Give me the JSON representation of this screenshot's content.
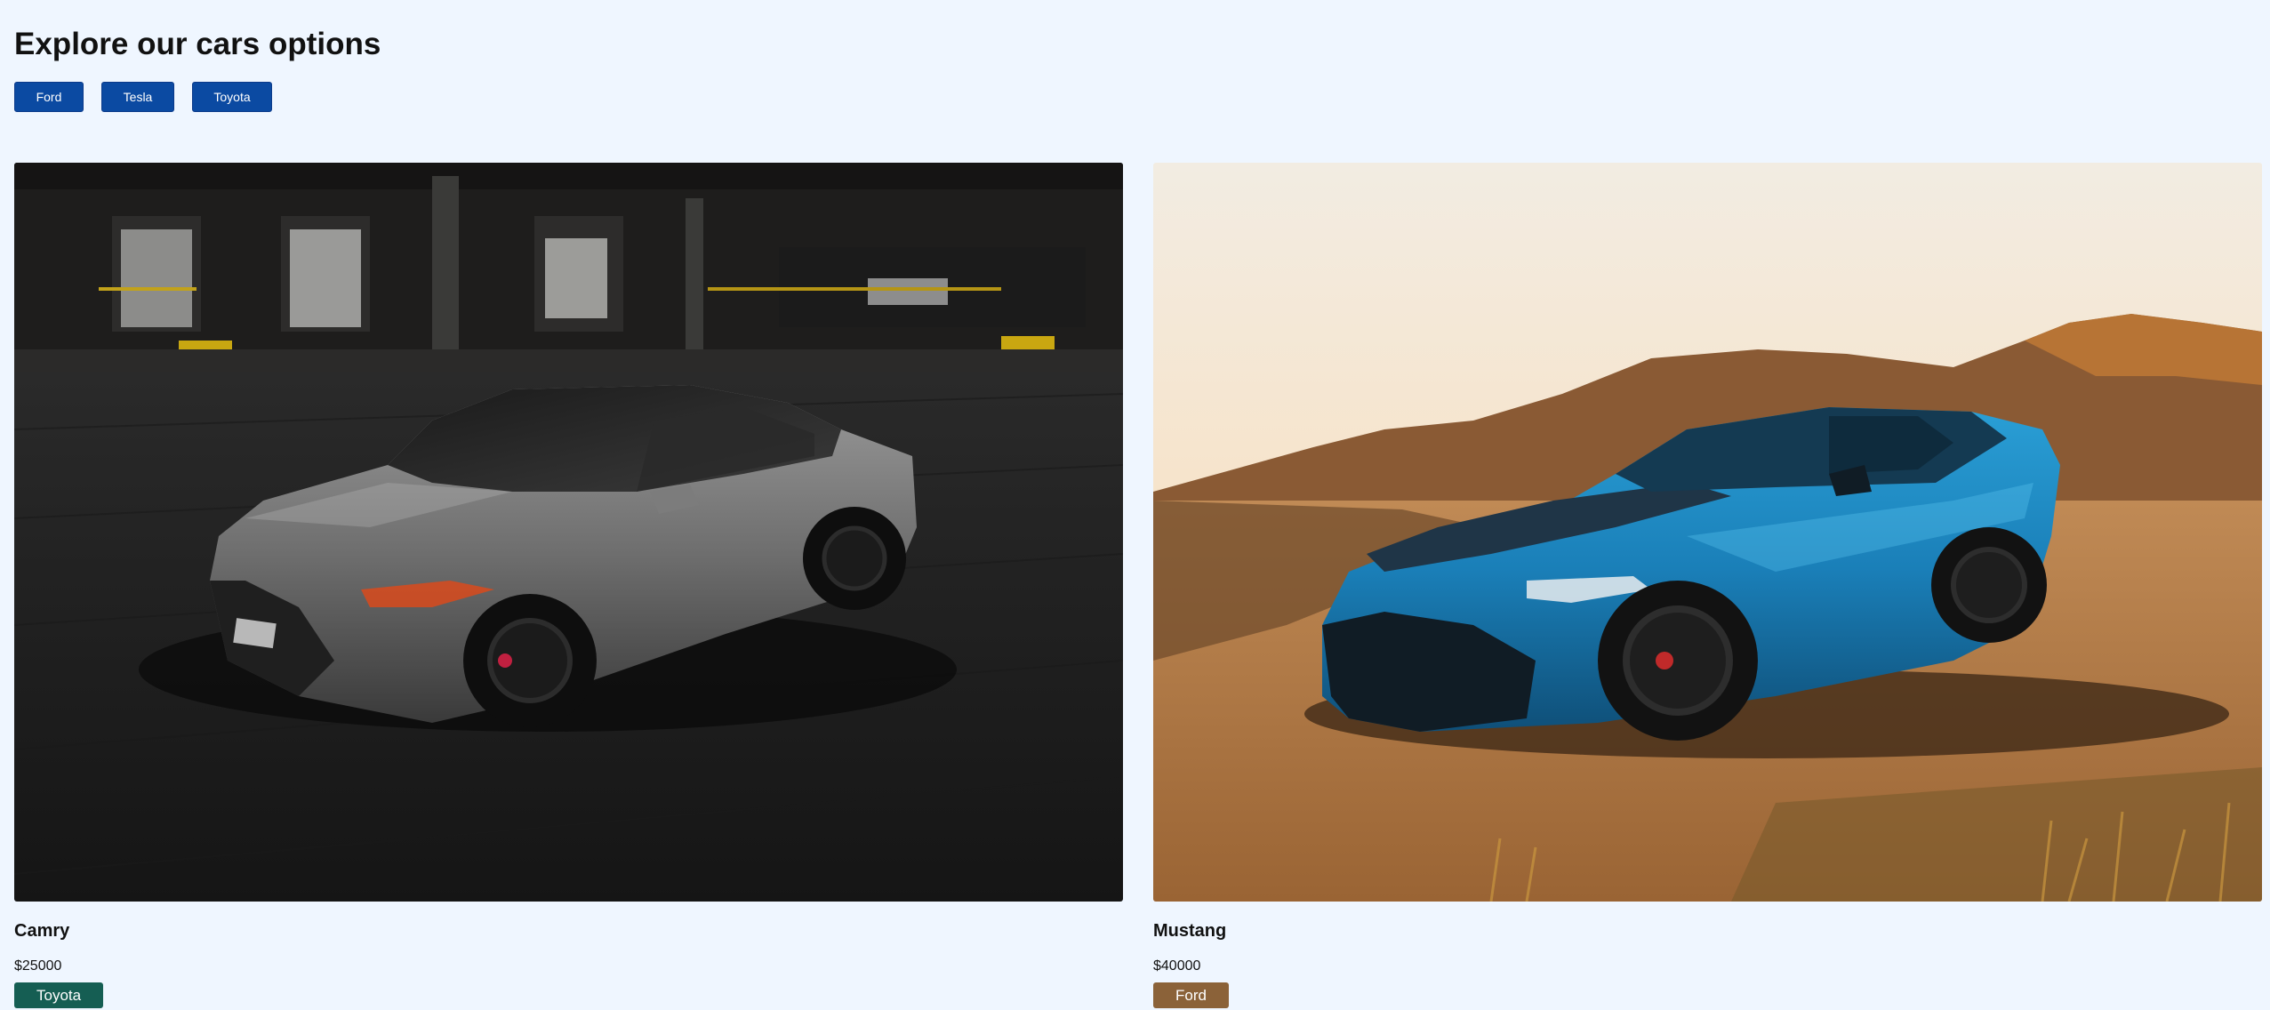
{
  "page": {
    "title": "Explore our cars options"
  },
  "filters": [
    {
      "label": "Ford"
    },
    {
      "label": "Tesla"
    },
    {
      "label": "Toyota"
    }
  ],
  "cars": [
    {
      "name": "Camry",
      "price": "$25000",
      "brand": "Toyota",
      "brand_color": "#155e53",
      "image": "grey-sedan-photo"
    },
    {
      "name": "Mustang",
      "price": "$40000",
      "brand": "Ford",
      "brand_color": "#8b6239",
      "image": "blue-coupe-desert-photo"
    }
  ],
  "colors": {
    "background": "#eff6ff",
    "filter_button": "#0b4aa2"
  }
}
